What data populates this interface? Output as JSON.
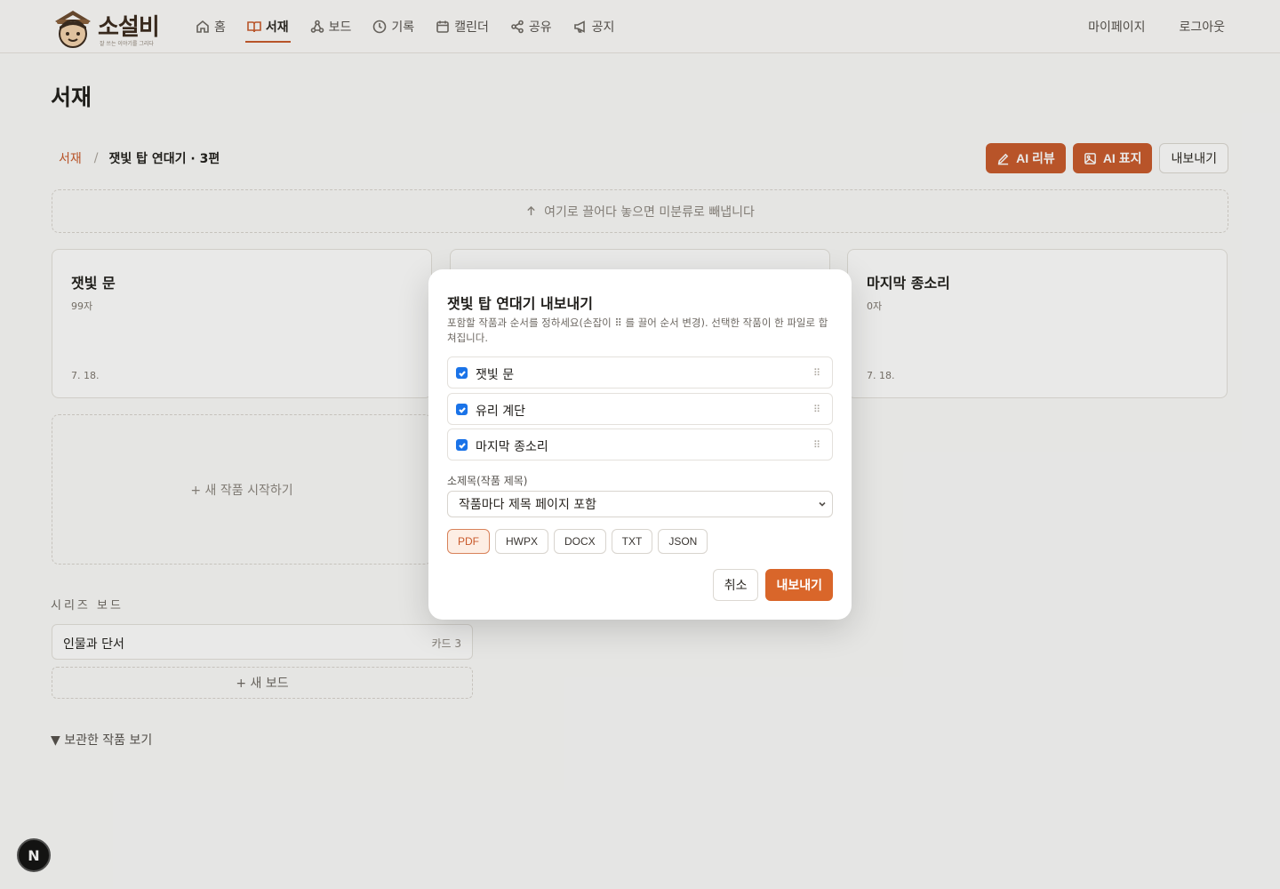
{
  "header": {
    "logo_text": "소설비",
    "logo_tagline": "잘 쓰는 이야기를 그리다",
    "nav": [
      {
        "label": "홈",
        "icon": "home-icon"
      },
      {
        "label": "서재",
        "icon": "book-icon",
        "active": true
      },
      {
        "label": "보드",
        "icon": "board-icon"
      },
      {
        "label": "기록",
        "icon": "clock-icon"
      },
      {
        "label": "캘린더",
        "icon": "calendar-icon"
      },
      {
        "label": "공유",
        "icon": "share-icon"
      },
      {
        "label": "공지",
        "icon": "megaphone-icon"
      }
    ],
    "mypage": "마이페이지",
    "logout": "로그아웃"
  },
  "page": {
    "title": "서재",
    "breadcrumb": {
      "root": "서재",
      "separator": "/",
      "current": "잿빛 탑 연대기 · 3편"
    },
    "actions": {
      "ai_review": "AI 리뷰",
      "ai_cover": "AI 표지",
      "export": "내보내기"
    },
    "dropzone": "여기로 끌어다 놓으면 미분류로 빼냅니다",
    "cards": [
      {
        "title": "잿빛 문",
        "count": "99자",
        "date": "7. 18."
      },
      {
        "title": "",
        "count": "",
        "date": ""
      },
      {
        "title": "마지막 종소리",
        "count": "0자",
        "date": "7. 18."
      }
    ],
    "new_work": "+ 새 작품 시작하기",
    "series_board_label": "시리즈 보드",
    "boards": [
      {
        "name": "인물과 단서",
        "count": "카드 3"
      }
    ],
    "new_board": "+ 새 보드",
    "archived": "▼ 보관한 작품 보기"
  },
  "modal": {
    "title": "잿빛 탑 연대기 내보내기",
    "description": "포함할 작품과 순서를 정하세요(손잡이 ⠿ 를 끌어 순서 변경). 선택한 작품이 한 파일로 합쳐집니다.",
    "works": [
      {
        "name": "잿빛 문",
        "checked": true
      },
      {
        "name": "유리 계단",
        "checked": true
      },
      {
        "name": "마지막 종소리",
        "checked": true
      }
    ],
    "subtitle_label": "소제목(작품 제목)",
    "subtitle_option": "작품마다 제목 페이지 포함",
    "formats": [
      "PDF",
      "HWPX",
      "DOCX",
      "TXT",
      "JSON"
    ],
    "selected_format": "PDF",
    "cancel": "취소",
    "export": "내보내기"
  },
  "dev_badge": "N",
  "colors": {
    "accent": "#c95a2b",
    "export_button": "#d9662a",
    "checkbox": "#1a73e8"
  }
}
